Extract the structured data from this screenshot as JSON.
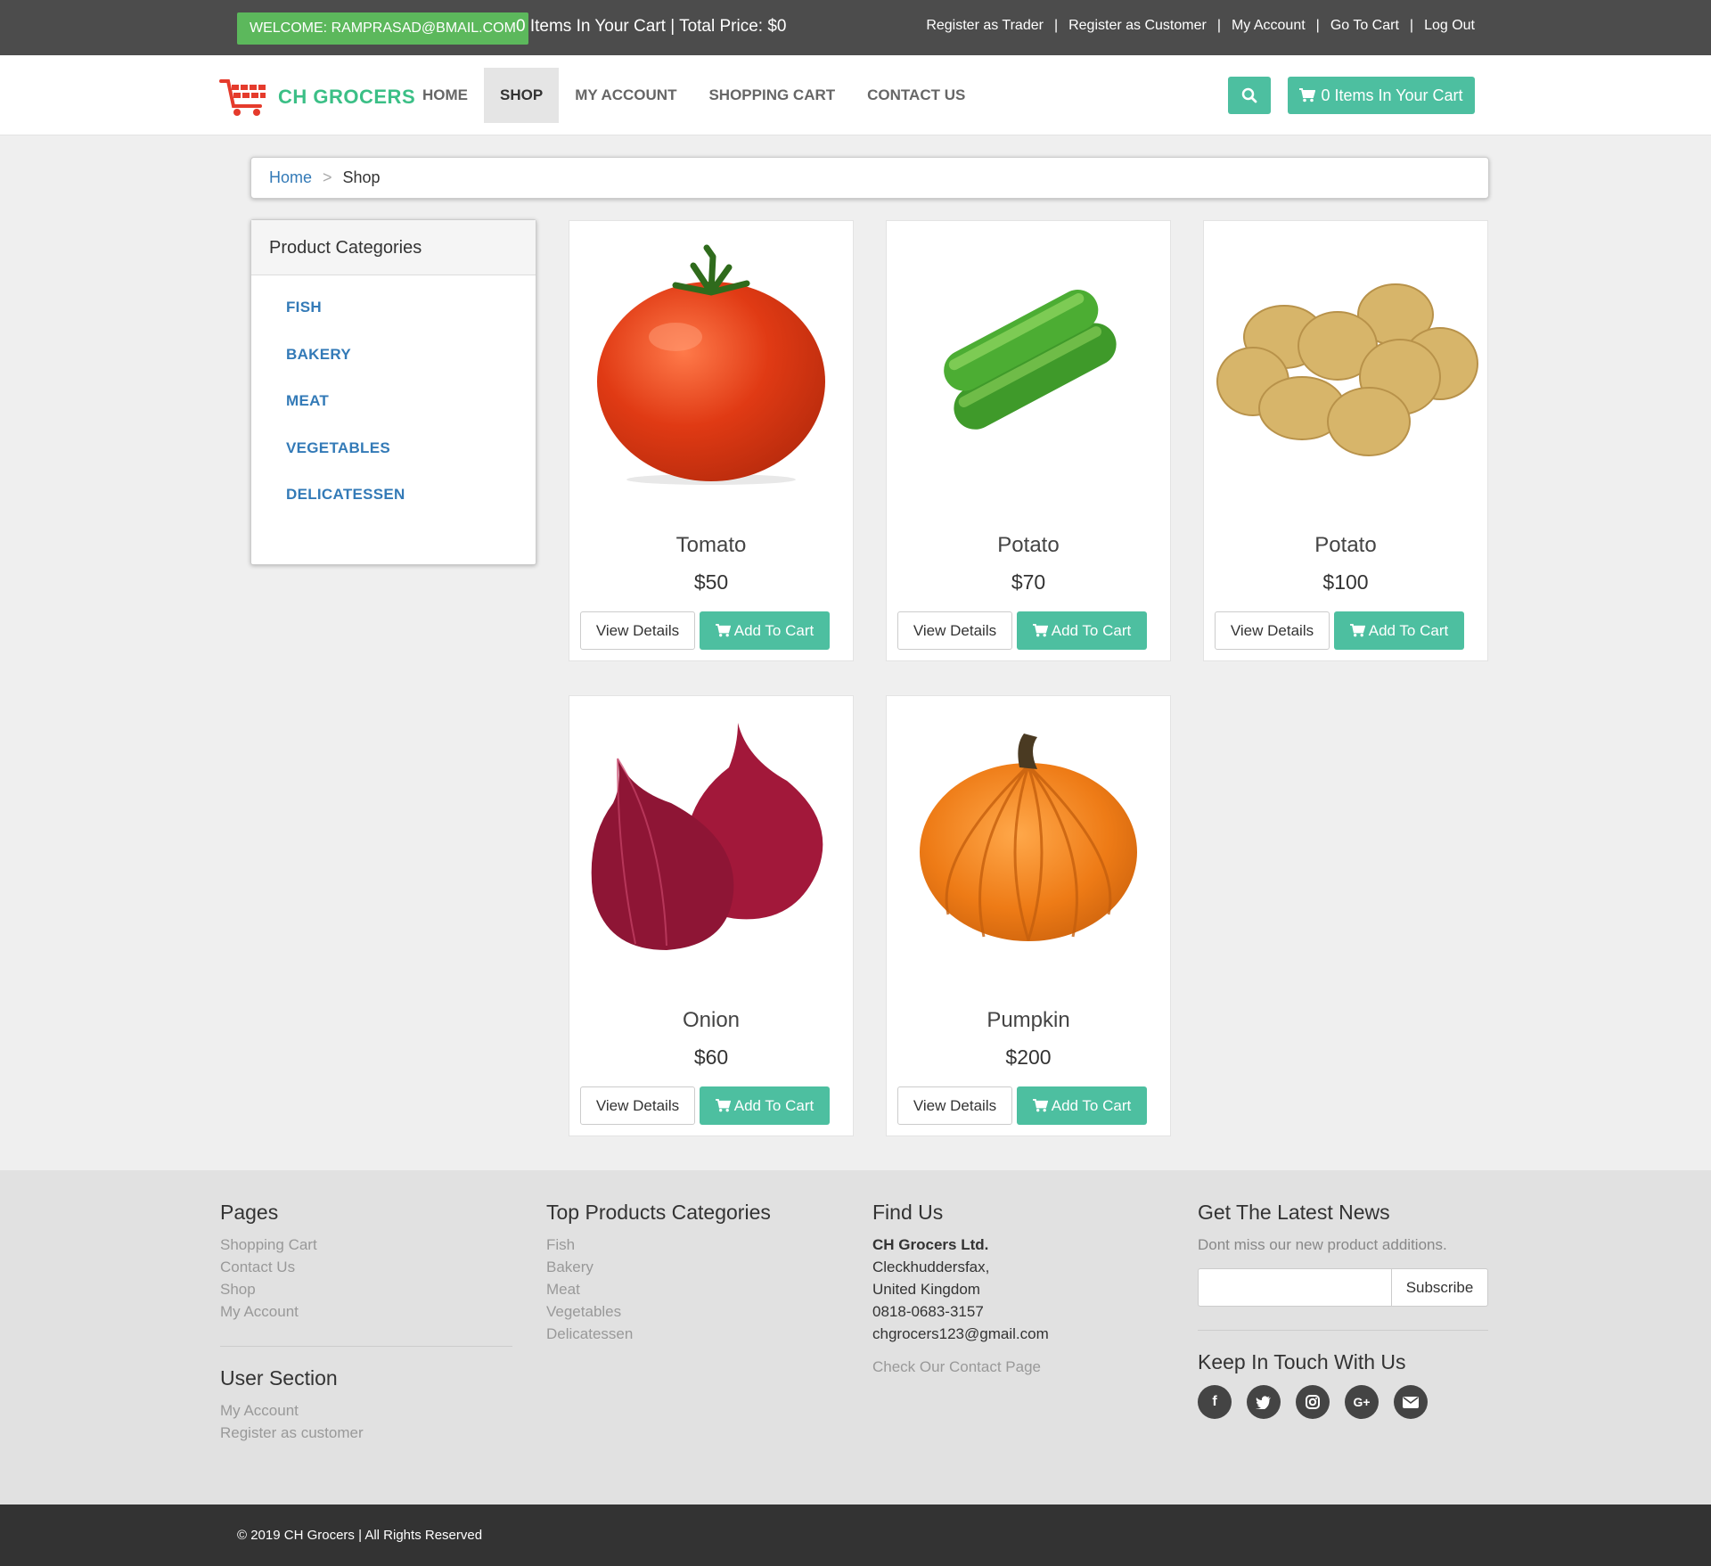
{
  "topbar": {
    "welcome": "WELCOME: RAMPRASAD@BMAIL.COM",
    "cart_info": "0 Items In Your Cart | Total Price: $0",
    "links": [
      "Register as Trader",
      "Register as Customer",
      "My Account",
      "Go To Cart",
      "Log Out"
    ]
  },
  "navbar": {
    "brand": "CH GROCERS",
    "items": [
      "HOME",
      "SHOP",
      "MY ACCOUNT",
      "SHOPPING CART",
      "CONTACT US"
    ],
    "active": "SHOP",
    "cart_button": "0 Items In Your Cart"
  },
  "breadcrumb": {
    "home": "Home",
    "separator": ">",
    "current": "Shop"
  },
  "sidebar": {
    "title": "Product Categories",
    "categories": [
      "FISH",
      "BAKERY",
      "MEAT",
      "VEGETABLES",
      "DELICATESSEN"
    ]
  },
  "products": [
    {
      "name": "Tomato",
      "price": "$50",
      "image": "tomato"
    },
    {
      "name": "Potato",
      "price": "$70",
      "image": "cucumber"
    },
    {
      "name": "Potato",
      "price": "$100",
      "image": "potatoes"
    },
    {
      "name": "Onion",
      "price": "$60",
      "image": "onion"
    },
    {
      "name": "Pumpkin",
      "price": "$200",
      "image": "pumpkin"
    }
  ],
  "product_buttons": {
    "view": "View Details",
    "add": "Add To Cart"
  },
  "footer": {
    "pages": {
      "title": "Pages",
      "links": [
        "Shopping Cart",
        "Contact Us",
        "Shop",
        "My Account"
      ]
    },
    "user_section": {
      "title": "User Section",
      "links": [
        "My Account",
        "Register as customer"
      ]
    },
    "top_categories": {
      "title": "Top Products Categories",
      "links": [
        "Fish",
        "Bakery",
        "Meat",
        "Vegetables",
        "Delicatessen"
      ]
    },
    "find_us": {
      "title": "Find Us",
      "company": "CH Grocers Ltd.",
      "lines": [
        "Cleckhuddersfax,",
        "United Kingdom",
        "0818-0683-3157",
        "chgrocers123@gmail.com"
      ],
      "contact_link": "Check Our Contact Page"
    },
    "news": {
      "title": "Get The Latest News",
      "text": "Dont miss our new product additions.",
      "input_placeholder": "",
      "button": "Subscribe"
    },
    "keep_in_touch": {
      "title": "Keep In Touch With Us",
      "icons": [
        "facebook-icon",
        "twitter-icon",
        "instagram-icon",
        "google-plus-icon",
        "envelope-icon"
      ]
    }
  },
  "copyright": "© 2019 CH Grocers | All Rights Reserved",
  "colors": {
    "accent": "#4dbfa0",
    "brand": "#3bbf86",
    "link": "#337ab7",
    "welcome": "#5cb85c",
    "topbar": "#4c4c4c"
  }
}
